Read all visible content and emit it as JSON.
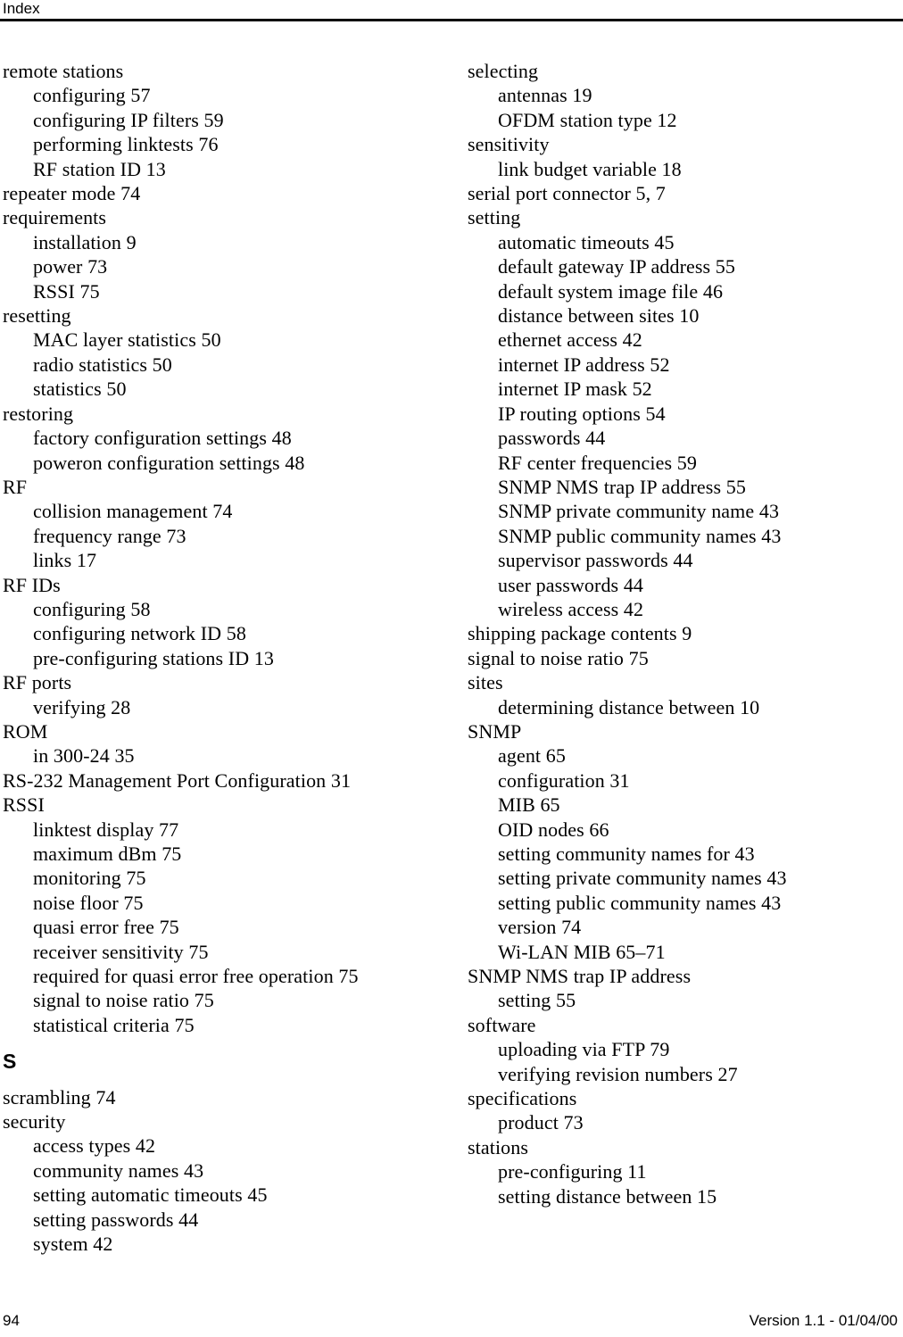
{
  "header": {
    "title": "Index"
  },
  "footer": {
    "page_number": "94",
    "version": "Version 1.1 - 01/04/00"
  },
  "columns": {
    "left": [
      {
        "type": "entry",
        "level": 0,
        "text": "remote stations"
      },
      {
        "type": "entry",
        "level": 1,
        "text": "configuring 57"
      },
      {
        "type": "entry",
        "level": 1,
        "text": "configuring IP filters 59"
      },
      {
        "type": "entry",
        "level": 1,
        "text": "performing linktests 76"
      },
      {
        "type": "entry",
        "level": 1,
        "text": "RF station ID 13"
      },
      {
        "type": "entry",
        "level": 0,
        "text": "repeater mode 74"
      },
      {
        "type": "entry",
        "level": 0,
        "text": "requirements"
      },
      {
        "type": "entry",
        "level": 1,
        "text": "installation 9"
      },
      {
        "type": "entry",
        "level": 1,
        "text": "power 73"
      },
      {
        "type": "entry",
        "level": 1,
        "text": "RSSI 75"
      },
      {
        "type": "entry",
        "level": 0,
        "text": "resetting"
      },
      {
        "type": "entry",
        "level": 1,
        "text": "MAC layer statistics 50"
      },
      {
        "type": "entry",
        "level": 1,
        "text": "radio statistics 50"
      },
      {
        "type": "entry",
        "level": 1,
        "text": "statistics 50"
      },
      {
        "type": "entry",
        "level": 0,
        "text": "restoring"
      },
      {
        "type": "entry",
        "level": 1,
        "text": "factory configuration settings 48"
      },
      {
        "type": "entry",
        "level": 1,
        "text": "poweron configuration settings 48"
      },
      {
        "type": "entry",
        "level": 0,
        "text": "RF"
      },
      {
        "type": "entry",
        "level": 1,
        "text": "collision management 74"
      },
      {
        "type": "entry",
        "level": 1,
        "text": "frequency range 73"
      },
      {
        "type": "entry",
        "level": 1,
        "text": "links 17"
      },
      {
        "type": "entry",
        "level": 0,
        "text": "RF IDs"
      },
      {
        "type": "entry",
        "level": 1,
        "text": "configuring 58"
      },
      {
        "type": "entry",
        "level": 1,
        "text": "configuring network ID 58"
      },
      {
        "type": "entry",
        "level": 1,
        "text": "pre-configuring stations ID 13"
      },
      {
        "type": "entry",
        "level": 0,
        "text": "RF ports"
      },
      {
        "type": "entry",
        "level": 1,
        "text": "verifying 28"
      },
      {
        "type": "entry",
        "level": 0,
        "text": "ROM"
      },
      {
        "type": "entry",
        "level": 1,
        "text": "in 300-24 35"
      },
      {
        "type": "entry",
        "level": 0,
        "text": "RS-232 Management Port Configuration 31"
      },
      {
        "type": "entry",
        "level": 0,
        "text": "RSSI"
      },
      {
        "type": "entry",
        "level": 1,
        "text": "linktest display 77"
      },
      {
        "type": "entry",
        "level": 1,
        "text": "maximum dBm 75"
      },
      {
        "type": "entry",
        "level": 1,
        "text": "monitoring 75"
      },
      {
        "type": "entry",
        "level": 1,
        "text": "noise floor 75"
      },
      {
        "type": "entry",
        "level": 1,
        "text": "quasi error free 75"
      },
      {
        "type": "entry",
        "level": 1,
        "text": "receiver sensitivity 75"
      },
      {
        "type": "entry",
        "level": 1,
        "text": "required for quasi error free operation 75"
      },
      {
        "type": "entry",
        "level": 1,
        "text": "signal to noise ratio 75"
      },
      {
        "type": "entry",
        "level": 1,
        "text": "statistical criteria 75"
      },
      {
        "type": "heading",
        "text": "S"
      },
      {
        "type": "entry",
        "level": 0,
        "text": "scrambling 74"
      },
      {
        "type": "entry",
        "level": 0,
        "text": "security"
      },
      {
        "type": "entry",
        "level": 1,
        "text": "access types 42"
      },
      {
        "type": "entry",
        "level": 1,
        "text": "community names 43"
      },
      {
        "type": "entry",
        "level": 1,
        "text": "setting automatic timeouts 45"
      },
      {
        "type": "entry",
        "level": 1,
        "text": "setting passwords 44"
      },
      {
        "type": "entry",
        "level": 1,
        "text": "system 42"
      }
    ],
    "right": [
      {
        "type": "entry",
        "level": 0,
        "text": "selecting"
      },
      {
        "type": "entry",
        "level": 1,
        "text": "antennas 19"
      },
      {
        "type": "entry",
        "level": 1,
        "text": "OFDM station type 12"
      },
      {
        "type": "entry",
        "level": 0,
        "text": "sensitivity"
      },
      {
        "type": "entry",
        "level": 1,
        "text": "link budget variable 18"
      },
      {
        "type": "entry",
        "level": 0,
        "text": "serial port connector 5, 7"
      },
      {
        "type": "entry",
        "level": 0,
        "text": "setting"
      },
      {
        "type": "entry",
        "level": 1,
        "text": "automatic timeouts 45"
      },
      {
        "type": "entry",
        "level": 1,
        "text": "default gateway IP address 55"
      },
      {
        "type": "entry",
        "level": 1,
        "text": "default system image file 46"
      },
      {
        "type": "entry",
        "level": 1,
        "text": "distance between sites 10"
      },
      {
        "type": "entry",
        "level": 1,
        "text": "ethernet access 42"
      },
      {
        "type": "entry",
        "level": 1,
        "text": "internet IP address 52"
      },
      {
        "type": "entry",
        "level": 1,
        "text": "internet IP mask 52"
      },
      {
        "type": "entry",
        "level": 1,
        "text": "IP routing options 54"
      },
      {
        "type": "entry",
        "level": 1,
        "text": "passwords 44"
      },
      {
        "type": "entry",
        "level": 1,
        "text": "RF center frequencies 59"
      },
      {
        "type": "entry",
        "level": 1,
        "text": "SNMP NMS trap IP address 55"
      },
      {
        "type": "entry",
        "level": 1,
        "text": "SNMP private community name 43"
      },
      {
        "type": "entry",
        "level": 1,
        "text": "SNMP public community names 43"
      },
      {
        "type": "entry",
        "level": 1,
        "text": "supervisor passwords 44"
      },
      {
        "type": "entry",
        "level": 1,
        "text": "user passwords 44"
      },
      {
        "type": "entry",
        "level": 1,
        "text": "wireless access 42"
      },
      {
        "type": "entry",
        "level": 0,
        "text": "shipping package contents 9"
      },
      {
        "type": "entry",
        "level": 0,
        "text": "signal to noise ratio 75"
      },
      {
        "type": "entry",
        "level": 0,
        "text": "sites"
      },
      {
        "type": "entry",
        "level": 1,
        "text": "determining distance between 10"
      },
      {
        "type": "entry",
        "level": 0,
        "text": "SNMP"
      },
      {
        "type": "entry",
        "level": 1,
        "text": "agent 65"
      },
      {
        "type": "entry",
        "level": 1,
        "text": "configuration 31"
      },
      {
        "type": "entry",
        "level": 1,
        "text": "MIB 65"
      },
      {
        "type": "entry",
        "level": 1,
        "text": "OID nodes 66"
      },
      {
        "type": "entry",
        "level": 1,
        "text": "setting community names for 43"
      },
      {
        "type": "entry",
        "level": 1,
        "text": "setting private community names 43"
      },
      {
        "type": "entry",
        "level": 1,
        "text": "setting public community names 43"
      },
      {
        "type": "entry",
        "level": 1,
        "text": "version 74"
      },
      {
        "type": "entry",
        "level": 1,
        "text": "Wi-LAN MIB 65–71"
      },
      {
        "type": "entry",
        "level": 0,
        "text": "SNMP NMS trap IP address"
      },
      {
        "type": "entry",
        "level": 1,
        "text": "setting 55"
      },
      {
        "type": "entry",
        "level": 0,
        "text": "software"
      },
      {
        "type": "entry",
        "level": 1,
        "text": "uploading via FTP 79"
      },
      {
        "type": "entry",
        "level": 1,
        "text": "verifying revision numbers 27"
      },
      {
        "type": "entry",
        "level": 0,
        "text": "specifications"
      },
      {
        "type": "entry",
        "level": 1,
        "text": "product 73"
      },
      {
        "type": "entry",
        "level": 0,
        "text": "stations"
      },
      {
        "type": "entry",
        "level": 1,
        "text": "pre-configuring 11"
      },
      {
        "type": "entry",
        "level": 1,
        "text": "setting distance between 15"
      }
    ]
  }
}
